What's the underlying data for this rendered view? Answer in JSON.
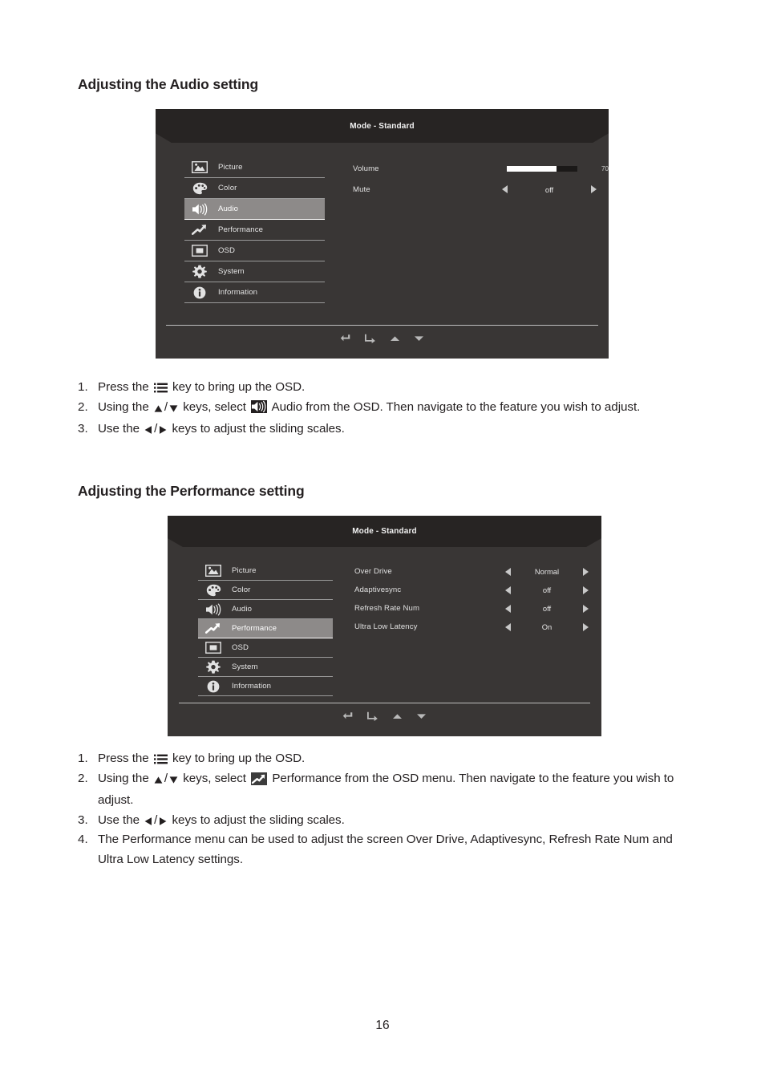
{
  "document": {
    "page_number": "16"
  },
  "sections": [
    {
      "heading": "Adjusting the Audio setting"
    },
    {
      "heading": "Adjusting the Performance setting"
    }
  ],
  "osd_audio": {
    "title": "Mode - Standard",
    "menu": [
      {
        "label": "Picture",
        "icon": "picture-icon",
        "active": false
      },
      {
        "label": "Color",
        "icon": "palette-icon",
        "active": false
      },
      {
        "label": "Audio",
        "icon": "speaker-icon",
        "active": true
      },
      {
        "label": "Performance",
        "icon": "trending-up-icon",
        "active": false
      },
      {
        "label": "OSD",
        "icon": "display-icon",
        "active": false
      },
      {
        "label": "System",
        "icon": "gear-icon",
        "active": false
      },
      {
        "label": "Information",
        "icon": "info-icon",
        "active": false
      }
    ],
    "settings": [
      {
        "label": "Volume",
        "type": "slider",
        "value": "70",
        "percent": 70
      },
      {
        "label": "Mute",
        "type": "arrows",
        "value": "off"
      }
    ],
    "footer_icons": [
      "back-arrow-icon",
      "enter-arrow-icon",
      "up-triangle-icon",
      "down-triangle-icon"
    ]
  },
  "osd_performance": {
    "title": "Mode - Standard",
    "menu": [
      {
        "label": "Picture",
        "icon": "picture-icon",
        "active": false
      },
      {
        "label": "Color",
        "icon": "palette-icon",
        "active": false
      },
      {
        "label": "Audio",
        "icon": "speaker-icon",
        "active": false
      },
      {
        "label": "Performance",
        "icon": "trending-up-icon",
        "active": true
      },
      {
        "label": "OSD",
        "icon": "display-icon",
        "active": false
      },
      {
        "label": "System",
        "icon": "gear-icon",
        "active": false
      },
      {
        "label": "Information",
        "icon": "info-icon",
        "active": false
      }
    ],
    "settings": [
      {
        "label": "Over Drive",
        "type": "arrows",
        "value": "Normal"
      },
      {
        "label": "Adaptivesync",
        "type": "arrows",
        "value": "off"
      },
      {
        "label": "Refresh Rate Num",
        "type": "arrows",
        "value": "off"
      },
      {
        "label": "Ultra Low Latency",
        "type": "arrows",
        "value": "On"
      }
    ],
    "footer_icons": [
      "back-arrow-icon",
      "enter-arrow-icon",
      "up-triangle-icon",
      "down-triangle-icon"
    ]
  },
  "steps_audio": [
    {
      "num": "1.",
      "parts": [
        {
          "t": "text",
          "v": "Press the "
        },
        {
          "t": "icon",
          "v": "menu-list-icon"
        },
        {
          "t": "text",
          "v": " key to bring up the OSD."
        }
      ]
    },
    {
      "num": "2.",
      "parts": [
        {
          "t": "text",
          "v": "Using the "
        },
        {
          "t": "icon",
          "v": "up-triangle-icon"
        },
        {
          "t": "text",
          "v": "/"
        },
        {
          "t": "icon",
          "v": "down-triangle-icon"
        },
        {
          "t": "text",
          "v": " keys, select "
        },
        {
          "t": "icon",
          "v": "speaker-icon-box"
        },
        {
          "t": "text",
          "v": " Audio from the OSD. Then navigate to the feature you wish to adjust."
        }
      ]
    },
    {
      "num": "3.",
      "parts": [
        {
          "t": "text",
          "v": "Use the "
        },
        {
          "t": "icon",
          "v": "left-triangle-icon"
        },
        {
          "t": "text",
          "v": "/"
        },
        {
          "t": "icon",
          "v": "right-triangle-icon"
        },
        {
          "t": "text",
          "v": " keys to adjust the sliding scales."
        }
      ]
    }
  ],
  "steps_performance": [
    {
      "num": "1.",
      "parts": [
        {
          "t": "text",
          "v": "Press the "
        },
        {
          "t": "icon",
          "v": "menu-list-icon"
        },
        {
          "t": "text",
          "v": " key to bring up the OSD."
        }
      ]
    },
    {
      "num": "2.",
      "parts": [
        {
          "t": "text",
          "v": "Using the "
        },
        {
          "t": "icon",
          "v": "up-triangle-icon"
        },
        {
          "t": "text",
          "v": "/"
        },
        {
          "t": "icon",
          "v": "down-triangle-icon"
        },
        {
          "t": "text",
          "v": " keys, select "
        },
        {
          "t": "icon",
          "v": "performance-icon-box"
        },
        {
          "t": "text",
          "v": " Performance from the OSD menu. Then navigate to the feature you wish to adjust."
        }
      ]
    },
    {
      "num": "3.",
      "parts": [
        {
          "t": "text",
          "v": "Use the "
        },
        {
          "t": "icon",
          "v": "left-triangle-icon"
        },
        {
          "t": "text",
          "v": "/"
        },
        {
          "t": "icon",
          "v": "right-triangle-icon"
        },
        {
          "t": "text",
          "v": " keys to adjust the sliding scales."
        }
      ]
    },
    {
      "num": "4.",
      "parts": [
        {
          "t": "text",
          "v": "The Performance menu can be used to adjust the screen Over Drive, Adaptivesync, Refresh Rate Num and Ultra Low Latency settings."
        }
      ]
    }
  ],
  "colors": {
    "osd_background": "#393635",
    "osd_header": "#272423",
    "osd_highlight": "#8d8a89",
    "osd_text": "#e4e4e4",
    "page_text": "#231f20"
  }
}
